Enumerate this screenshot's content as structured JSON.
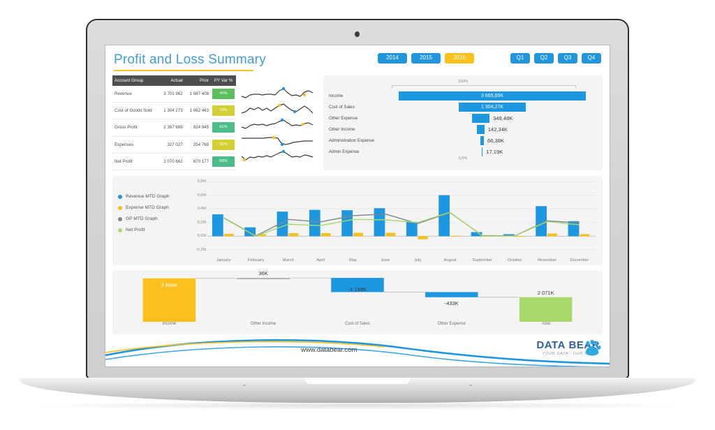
{
  "device": {
    "kind": "laptop-mockup"
  },
  "dashboard": {
    "title": "Profit and Loss Summary",
    "slicers": {
      "years": [
        {
          "label": "2014",
          "selected": false
        },
        {
          "label": "2015",
          "selected": false
        },
        {
          "label": "2016",
          "selected": true
        }
      ],
      "quarters": [
        {
          "label": "Q1",
          "selected": false
        },
        {
          "label": "Q2",
          "selected": false
        },
        {
          "label": "Q3",
          "selected": false
        },
        {
          "label": "Q4",
          "selected": false
        }
      ]
    },
    "table": {
      "headers": [
        "Account Group",
        "Actual",
        "Prior",
        "PY Var %"
      ],
      "rows": [
        {
          "group": "Revenue",
          "actual": "3 701 962",
          "prior": "1 987 408",
          "var": "46%",
          "var_color": "#5cbd5c"
        },
        {
          "group": "Cost of Goods Sold",
          "actual": "1 304 273",
          "prior": "1 062 463",
          "var": "19%",
          "var_color": "#d4cf32"
        },
        {
          "group": "Gross Profit",
          "actual": "2 397 689",
          "prior": "924 945",
          "var": "61%",
          "var_color": "#4cbd8a"
        },
        {
          "group": "Expenses",
          "actual": "327 027",
          "prior": "254 768",
          "var": "22%",
          "var_color": "#d4cf32"
        },
        {
          "group": "Net Profit",
          "actual": "2 070 662",
          "prior": "670 177",
          "var": "68%",
          "var_color": "#4cbd8a"
        }
      ]
    },
    "funnel": {
      "top_label": "100%",
      "bottom_label": "0,5%",
      "rows": [
        {
          "label": "Income",
          "value": "3 665,65K",
          "width_pct": 100.0,
          "inside": true
        },
        {
          "label": "Cost of Sales",
          "value": "1 304,27K",
          "width_pct": 35.6,
          "inside": true
        },
        {
          "label": "Other Expense",
          "value": "349,48K",
          "width_pct": 9.5,
          "inside": false
        },
        {
          "label": "Other Income",
          "value": "142,34K",
          "width_pct": 4.0,
          "inside": false
        },
        {
          "label": "Administration Expense",
          "value": "66,38K",
          "width_pct": 1.9,
          "inside": false
        },
        {
          "label": "Admin Expense",
          "value": "17,19K",
          "width_pct": 0.6,
          "inside": false
        }
      ]
    },
    "footer": {
      "url": "www.databear.com"
    },
    "brand": {
      "name_first": "DATA",
      "name_second": "BEAR",
      "tagline": "YOUR DATA - OUR STORY"
    }
  },
  "colors": {
    "blue": "#1c97e0",
    "yellow": "#fbc01c",
    "green": "#a9d96b",
    "gray_line": "#7c8a8f",
    "title_blue": "#3f9fd6",
    "underline_yellow": "#ffc423"
  },
  "chart_data": [
    {
      "type": "bar",
      "name": "monthly-combo-chart",
      "title": "",
      "xlabel": "",
      "ylabel": "",
      "ylim": [
        -0.2,
        0.8
      ],
      "yticks": [
        "0,8M",
        "0,6M",
        "0,4M",
        "0,2M",
        "0,0M",
        "-0,2M"
      ],
      "ytick_values": [
        0.8,
        0.6,
        0.4,
        0.2,
        0.0,
        -0.2
      ],
      "grid": true,
      "legend_position": "left",
      "categories": [
        "January",
        "February",
        "March",
        "April",
        "May",
        "June",
        "July",
        "August",
        "September",
        "October",
        "November",
        "December"
      ],
      "series": [
        {
          "name": "Revenue MTD Graph",
          "kind": "bar",
          "color": "#1c97e0",
          "values": [
            0.32,
            0.13,
            0.36,
            0.385,
            0.38,
            0.41,
            0.21,
            0.6,
            0.06,
            0.03,
            0.44,
            0.22
          ]
        },
        {
          "name": "Expense MTD Graph",
          "kind": "bar",
          "color": "#fbc01c",
          "values": [
            0.035,
            0.03,
            0.045,
            0.045,
            0.05,
            0.05,
            -0.045,
            0.005,
            0.004,
            0.003,
            0.04,
            0.03
          ]
        },
        {
          "name": "GP MTD Graph",
          "kind": "line",
          "color": "#7c8a8f",
          "values": [
            0.27,
            0.005,
            0.245,
            0.21,
            0.3,
            0.325,
            0.185,
            0.345,
            0.01,
            0.005,
            0.225,
            0.195
          ]
        },
        {
          "name": "Net Profit",
          "kind": "line",
          "color": "#a9d96b",
          "values": [
            0.265,
            0.0,
            0.175,
            0.155,
            0.245,
            0.24,
            0.2,
            0.35,
            0.005,
            0.003,
            0.215,
            0.165
          ]
        }
      ]
    },
    {
      "type": "bar",
      "name": "profit-waterfall-chart",
      "subtype": "waterfall",
      "title": "",
      "categories": [
        "Income",
        "Other Income",
        "Cost of Sales",
        "Other Expense",
        "Total"
      ],
      "labels": [
        "3 666K",
        "36K",
        "-1 198K",
        "-433K",
        "2 071K"
      ],
      "deltas": [
        3666,
        36,
        -1198,
        -433,
        null
      ],
      "total": 2071,
      "colors": [
        "#fbc01c",
        "#b3b3b3",
        "#1c97e0",
        "#1c97e0",
        "#a9d96b"
      ],
      "label_inside": [
        true,
        false,
        false,
        false,
        false
      ]
    }
  ]
}
